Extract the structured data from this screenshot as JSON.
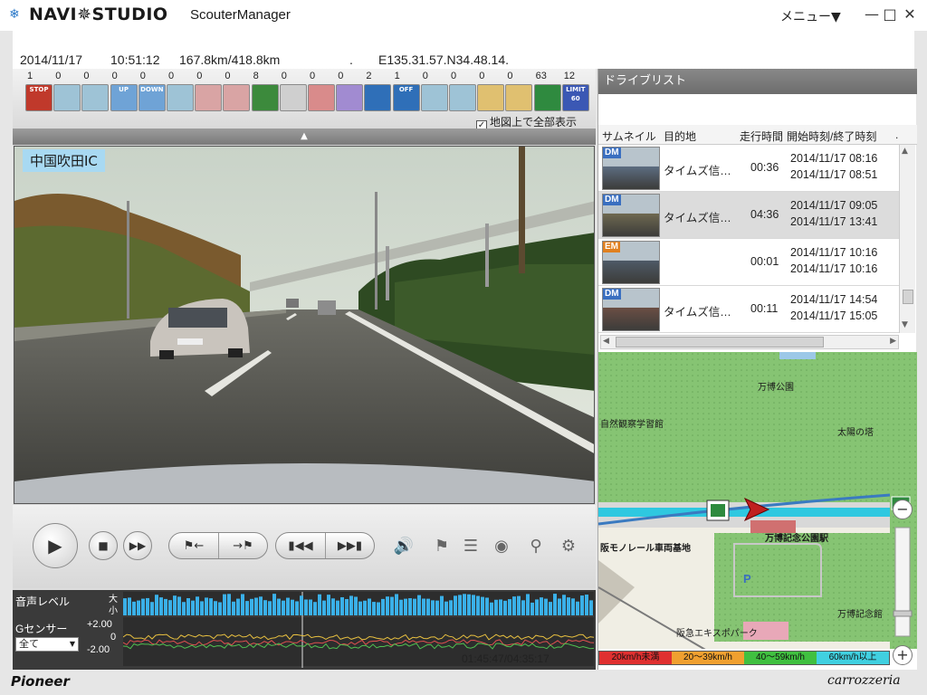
{
  "window": {
    "brand": "NAVI✵STUDIO",
    "app_title": "ScouterManager",
    "menu_label": "メニュー▼",
    "minimize": "—",
    "maximize": "□",
    "close": "✕"
  },
  "status": {
    "date": "2014/11/17",
    "time": "10:51:12",
    "distance": "167.8km/418.8km",
    "separator": ".",
    "coords": "E135.31.57.N34.48.14."
  },
  "events": [
    {
      "count": "1",
      "icon": "stop-icon",
      "label": "STOP",
      "color": "#c0392b"
    },
    {
      "count": "0",
      "icon": "arrow-left-icon",
      "label": "",
      "color": "#9ec3d6"
    },
    {
      "count": "0",
      "icon": "arrow-right-icon",
      "label": "",
      "color": "#9ec3d6"
    },
    {
      "count": "0",
      "icon": "up-icon",
      "label": "UP",
      "color": "#6fa3d6"
    },
    {
      "count": "0",
      "icon": "down-icon",
      "label": "DOWN",
      "color": "#6fa3d6"
    },
    {
      "count": "0",
      "icon": "back-arrow-icon",
      "label": "",
      "color": "#9ec3d6"
    },
    {
      "count": "0",
      "icon": "warning-icon",
      "label": "",
      "color": "#d9a4a4"
    },
    {
      "count": "0",
      "icon": "warning-icon",
      "label": "",
      "color": "#d9a4a4"
    },
    {
      "count": "8",
      "icon": "curve-icon",
      "label": "",
      "color": "#3c8a3c"
    },
    {
      "count": "0",
      "icon": "dots-icon",
      "label": "",
      "color": "#cfcfcf"
    },
    {
      "count": "0",
      "icon": "car-icon",
      "label": "",
      "color": "#d98b8b"
    },
    {
      "count": "0",
      "icon": "loop-icon",
      "label": "",
      "color": "#a18bd1"
    },
    {
      "count": "2",
      "icon": "interchange-icon",
      "label": "",
      "color": "#2f6fb8"
    },
    {
      "count": "1",
      "icon": "off-icon",
      "label": "OFF",
      "color": "#2f6fb8"
    },
    {
      "count": "0",
      "icon": "flag-icon",
      "label": "",
      "color": "#9ec3d6"
    },
    {
      "count": "0",
      "icon": "route-icon",
      "label": "",
      "color": "#9ec3d6"
    },
    {
      "count": "0",
      "icon": "book-icon",
      "label": "",
      "color": "#e0c070"
    },
    {
      "count": "0",
      "icon": "collision-icon",
      "label": "",
      "color": "#e0c070"
    },
    {
      "count": "63",
      "icon": "highway-sign-icon",
      "label": "",
      "color": "#2f8a3f"
    },
    {
      "count": "12",
      "icon": "speed-limit-icon",
      "label": "LIMIT 60",
      "color": "#3b58b4"
    }
  ],
  "show_all_on_map": "地図上で全部表示",
  "collapse_arrow": "▲",
  "video": {
    "location": "中国吹田IC"
  },
  "graph": {
    "audio_level": "音声レベル",
    "audio_high": "大",
    "audio_low": "小",
    "g_sensor": "Gセンサー",
    "g_plus": "+2.00",
    "g_zero": "0",
    "g_minus": "-2.00",
    "axis_select": "全て",
    "playback_time": "01:45:47/04:35:17"
  },
  "drive_list": {
    "title": "ドライブリスト",
    "columns": [
      "サムネイル",
      "目的地",
      "走行時間",
      "開始時刻/終了時刻",
      "."
    ],
    "rows": [
      {
        "tag": "DM",
        "tag_color": "#3a6fc0",
        "destination": "タイムズ信…",
        "duration": "00:36",
        "start": "2014/11/17 08:16",
        "end": "2014/11/17 08:51"
      },
      {
        "tag": "DM",
        "tag_color": "#3a6fc0",
        "destination": "タイムズ信…",
        "duration": "04:36",
        "start": "2014/11/17 09:05",
        "end": "2014/11/17 13:41"
      },
      {
        "tag": "EM",
        "tag_color": "#e08020",
        "destination": "",
        "duration": "00:01",
        "start": "2014/11/17 10:16",
        "end": "2014/11/17 10:16"
      },
      {
        "tag": "DM",
        "tag_color": "#3a6fc0",
        "destination": "タイムズ信…",
        "duration": "00:11",
        "start": "2014/11/17 14:54",
        "end": "2014/11/17 15:05"
      }
    ]
  },
  "map": {
    "labels": {
      "expo_park": "万博公園",
      "nature_center": "自然観察学習館",
      "tower_of_sun": "太陽の塔",
      "station": "万博記念公園駅",
      "monorail_depot": "阪モノレール車両基地",
      "hall": "万博記念館",
      "expo_park_hankyu": "阪急エキスポパーク",
      "parking": "P"
    },
    "speed_legend": [
      "20km/h未満",
      "20〜39km/h",
      "40〜59km/h",
      "60km/h以上"
    ],
    "speed_colors": [
      "#e03030",
      "#f0a030",
      "#40c040",
      "#40d0e0"
    ],
    "zoom_out": "−",
    "zoom_in": "+"
  },
  "footer": {
    "left_brand": "Pioneer",
    "right_brand": "carrozzeria"
  },
  "colors": {
    "accent": "#2a78c8",
    "panel_header": "#7a7a7a",
    "audio_bar": "#3ab0e8"
  }
}
